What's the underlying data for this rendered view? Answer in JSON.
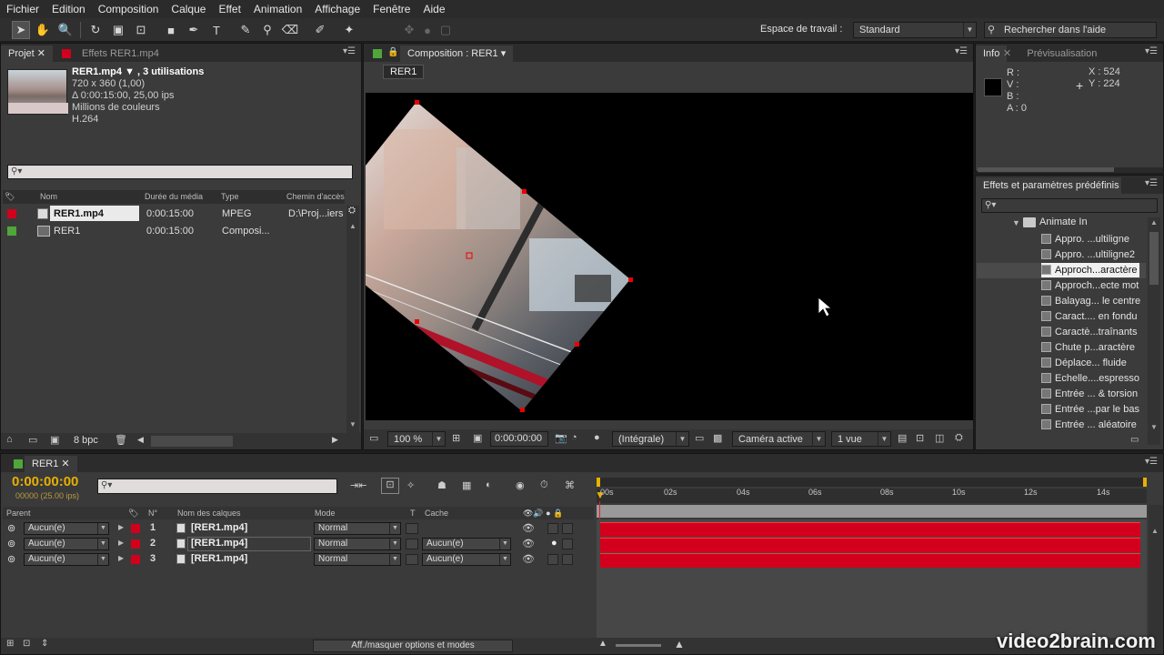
{
  "menu": [
    "Fichier",
    "Edition",
    "Composition",
    "Calque",
    "Effet",
    "Animation",
    "Affichage",
    "Fenêtre",
    "Aide"
  ],
  "toolbar": {
    "workspace_label": "Espace de travail :",
    "workspace_value": "Standard",
    "help_placeholder": "Rechercher dans l'aide"
  },
  "project": {
    "tab_project": "Projet",
    "tab_effects": "Effets RER1.mp4",
    "item_name": "RER1.mp4 ▼ , 3 utilisations",
    "info_lines": [
      "720 x 360 (1,00)",
      "Δ 0:00:15:00, 25,00 ips",
      "Millions de couleurs",
      "H.264"
    ],
    "search_placeholder": "",
    "columns": [
      "Nom",
      "Durée du média",
      "Type",
      "Chemin d'accès"
    ],
    "rows": [
      {
        "name": "RER1.mp4",
        "duration": "0:00:15:00",
        "type": "MPEG",
        "path": "D:\\Proj...iers",
        "color": "#d1001c"
      },
      {
        "name": "RER1",
        "duration": "0:00:15:00",
        "type": "Composi...",
        "path": "",
        "color": "#4fa63a"
      }
    ],
    "bpc": "8 bpc"
  },
  "composition": {
    "tab": "Composition : RER1",
    "subtab": "RER1",
    "zoom": "100 %",
    "timecode": "0:00:00:00",
    "resolution": "(Intégrale)",
    "camera": "Caméra active",
    "views": "1 vue"
  },
  "info": {
    "tab_info": "Info",
    "tab_preview": "Prévisualisation",
    "r": "R :",
    "v": "V :",
    "b": "B :",
    "a": "A : 0",
    "x": "X : 524",
    "y": "Y : 224"
  },
  "effects": {
    "tab": "Effets et paramètres prédéfinis",
    "folder": "Animate In",
    "items": [
      "Appro. ...ultiligne",
      "Appro. ...ultiligne2",
      "Approch...aractère",
      "Approch...ecte mot",
      "Balayag... le centre",
      "Caract.... en fondu",
      "Caractè...traînants",
      "Chute p...aractère",
      "Déplace... fluide",
      "Echelle....espresso",
      "Entrée ... & torsion",
      "Entrée ...par le bas",
      "Entrée ... aléatoire"
    ]
  },
  "timeline": {
    "tab": "RER1",
    "timecode": "0:00:00:00",
    "fps": "00000 (25.00 ips)",
    "col_parent": "Parent",
    "col_num": "N°",
    "col_name": "Nom des calques",
    "col_mode": "Mode",
    "col_t": "T",
    "col_cache": "Cache",
    "ruler": [
      "00s",
      "02s",
      "04s",
      "06s",
      "08s",
      "10s",
      "12s",
      "14s"
    ],
    "layers": [
      {
        "parent": "Aucun(e)",
        "num": "1",
        "name": "[RER1.mp4]",
        "mode": "Normal",
        "cache": ""
      },
      {
        "parent": "Aucun(e)",
        "num": "2",
        "name": "[RER1.mp4]",
        "mode": "Normal",
        "cache": "Aucun(e)"
      },
      {
        "parent": "Aucun(e)",
        "num": "3",
        "name": "[RER1.mp4]",
        "mode": "Normal",
        "cache": "Aucun(e)"
      }
    ],
    "toggle_label": "Aff./masquer options et modes"
  },
  "watermark": "video2brain.com"
}
